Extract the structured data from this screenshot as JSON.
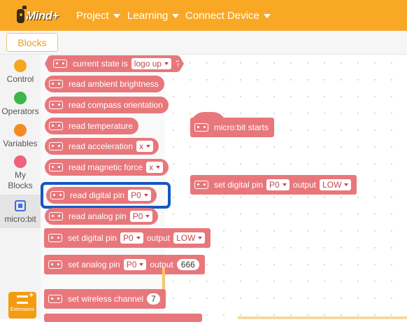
{
  "app": {
    "logo_text": "Mind+"
  },
  "menu": [
    {
      "label": "Project"
    },
    {
      "label": "Learning"
    },
    {
      "label": "Connect Device"
    }
  ],
  "tabs": {
    "blocks": "Blocks"
  },
  "categories": [
    {
      "label": "Control",
      "color": "#f5a623"
    },
    {
      "label": "Operators",
      "color": "#3cb54a"
    },
    {
      "label": "Variables",
      "color": "#f58a25"
    },
    {
      "label": "My Blocks",
      "color": "#f0627a"
    },
    {
      "label": "micro:bit",
      "color": "#3b6fd8"
    }
  ],
  "extensions_label": "Extensions",
  "palette": {
    "current_state": {
      "text": "current state is",
      "dropdown": "logo up",
      "suffix": "?"
    },
    "ambient": "read ambient brightness",
    "compass": "read compass orientation",
    "temperature": "read temperature",
    "acceleration": {
      "text": "read acceleration",
      "dropdown": "x"
    },
    "magnetic": {
      "text": "read magnetic force",
      "dropdown": "x"
    },
    "digital_pin": {
      "text": "read digital pin",
      "dropdown": "P0"
    },
    "analog_pin": {
      "text": "read analog pin",
      "dropdown": "P0"
    },
    "set_digital": {
      "text": "set digital pin",
      "pin": "P0",
      "mid": "output",
      "value": "LOW"
    },
    "set_analog": {
      "text": "set analog pin",
      "pin": "P0",
      "mid": "output",
      "value": "666"
    },
    "wireless": {
      "text": "set wireless channel",
      "value": "7"
    }
  },
  "workspace": {
    "hat": "micro:bit starts",
    "set_digital": {
      "text": "set digital pin",
      "pin": "P0",
      "mid": "output",
      "value": "LOW"
    }
  },
  "colors": {
    "topbar": "#f9a825",
    "block": "#e8777b",
    "selection": "#1557c0"
  }
}
